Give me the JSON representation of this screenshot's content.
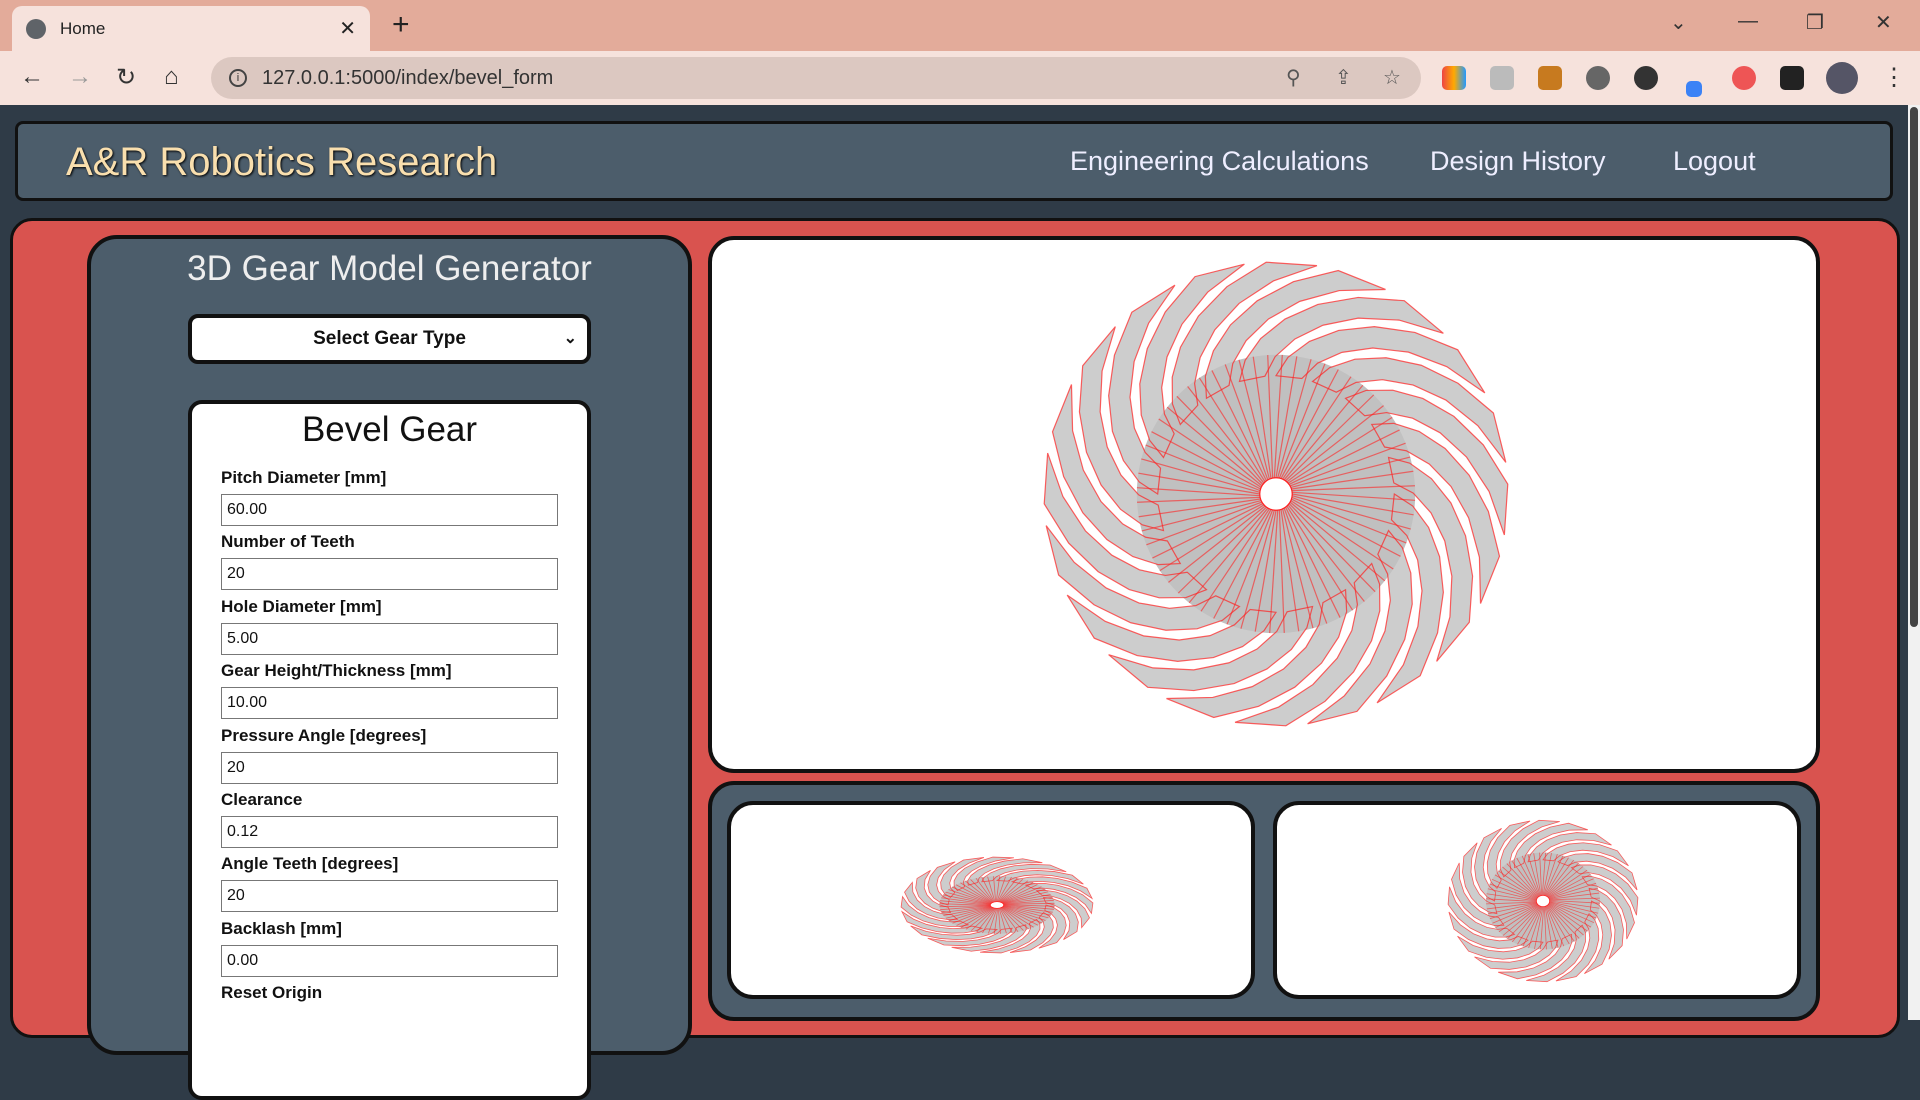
{
  "browser": {
    "tab_title": "Home",
    "url": "127.0.0.1:5000/index/bevel_form"
  },
  "navbar": {
    "brand": "A&R Robotics Research",
    "links": [
      "Engineering Calculations",
      "Design History",
      "Logout"
    ]
  },
  "generator": {
    "title": "3D Gear Model Generator",
    "gear_type_select": "Select Gear Type"
  },
  "form": {
    "title": "Bevel Gear",
    "fields": [
      {
        "label": "Pitch Diameter [mm]",
        "value": "60.00"
      },
      {
        "label": "Number of Teeth",
        "value": "20"
      },
      {
        "label": "Hole Diameter [mm]",
        "value": "5.00"
      },
      {
        "label": "Gear Height/Thickness [mm]",
        "value": "10.00"
      },
      {
        "label": "Pressure Angle [degrees]",
        "value": "20"
      },
      {
        "label": "Clearance",
        "value": "0.12"
      },
      {
        "label": "Angle Teeth [degrees]",
        "value": "20"
      },
      {
        "label": "Backlash [mm]",
        "value": "0.00"
      }
    ],
    "last_label": "Reset Origin"
  },
  "colors": {
    "wire": "#ff2020",
    "body": "#c0c0c0",
    "panel": "#4c5d6b",
    "accent": "#d9534f"
  }
}
